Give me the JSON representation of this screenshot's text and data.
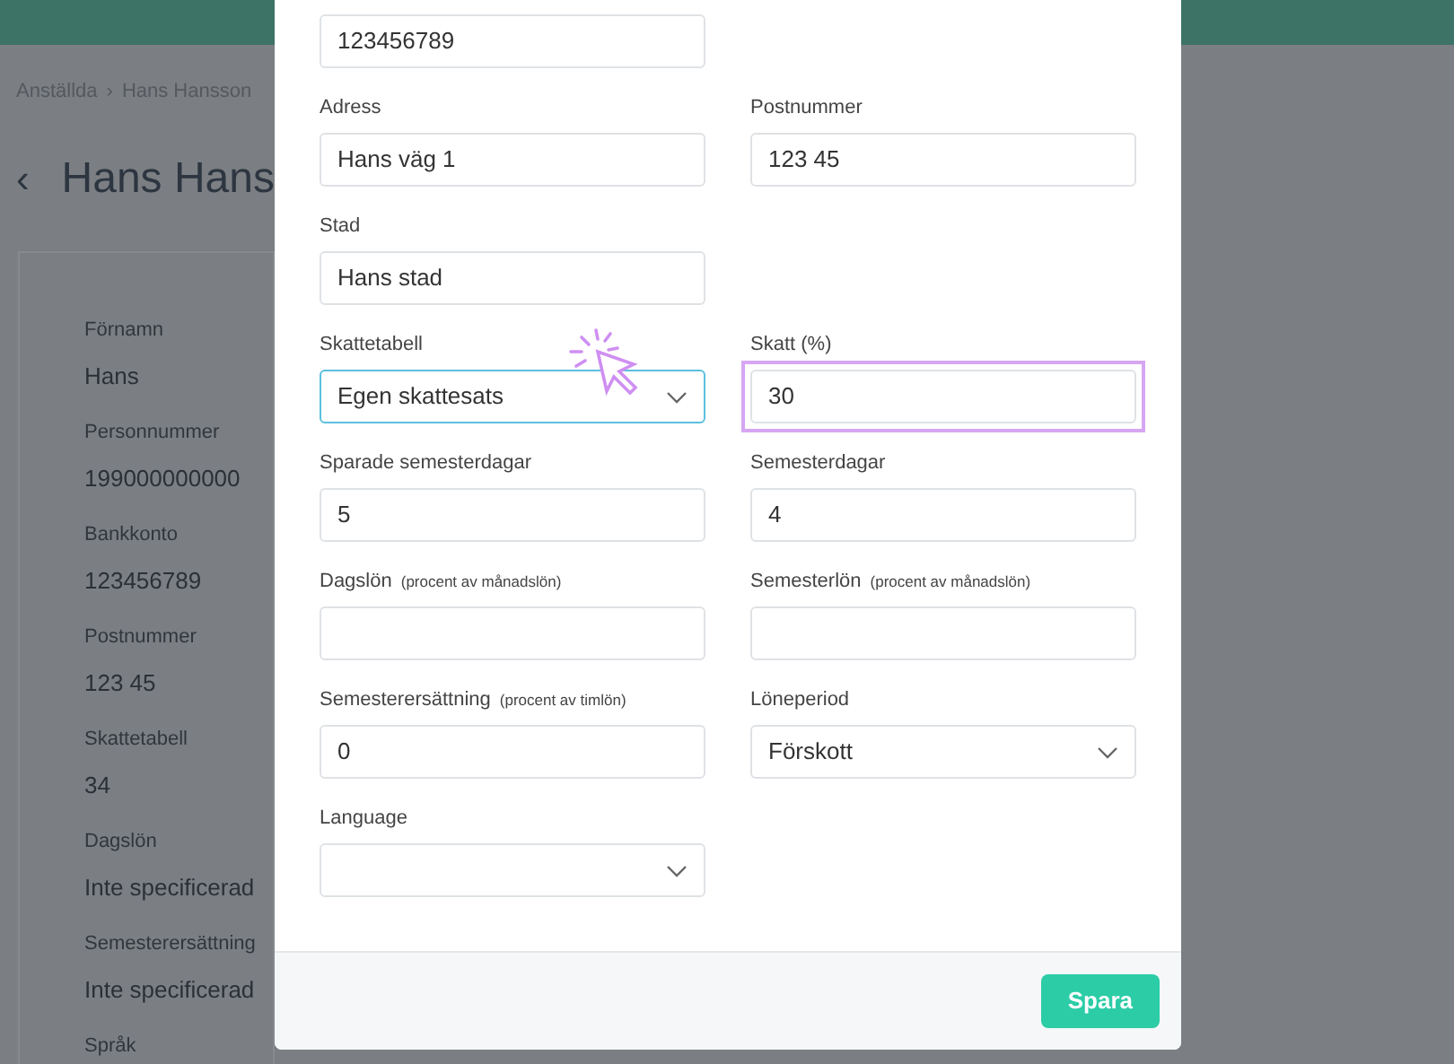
{
  "background": {
    "breadcrumb": [
      {
        "label": "Anställda"
      },
      {
        "label": "Hans Hansson"
      }
    ],
    "separator": "›",
    "back": "‹",
    "title": "Hans Hans",
    "details": [
      {
        "label": "Förnamn",
        "value": "Hans"
      },
      {
        "label": "Personnummer",
        "value": "199000000000"
      },
      {
        "label": "Bankkonto",
        "value": "123456789"
      },
      {
        "label": "Postnummer",
        "value": "123 45"
      },
      {
        "label": "Skattetabell",
        "value": "34"
      },
      {
        "label": "Dagslön",
        "value": "Inte specificerad"
      },
      {
        "label": "Semesterersättning",
        "value": "Inte specificerad"
      },
      {
        "label": "Språk"
      }
    ]
  },
  "modal": {
    "rows": [
      {
        "left": {
          "kind": "input",
          "value": "123456789",
          "focused": false,
          "highlighted": false
        }
      },
      {
        "left": {
          "kind": "input",
          "label": "Adress",
          "value": "Hans väg 1",
          "focused": false,
          "highlighted": false
        },
        "right": {
          "kind": "input",
          "label": "Postnummer",
          "value": "123 45",
          "focused": false,
          "highlighted": false
        }
      },
      {
        "left": {
          "kind": "input",
          "label": "Stad",
          "value": "Hans stad",
          "focused": false,
          "highlighted": false
        }
      },
      {
        "left": {
          "kind": "select",
          "label": "Skattetabell",
          "value": "Egen skattesats",
          "focused": true,
          "highlighted": false,
          "cursor": true
        },
        "right": {
          "kind": "input",
          "label": "Skatt (%)",
          "value": "30",
          "focused": false,
          "highlighted": true
        }
      },
      {
        "left": {
          "kind": "input",
          "label": "Sparade semesterdagar",
          "value": "5",
          "focused": false,
          "highlighted": false
        },
        "right": {
          "kind": "input",
          "label": "Semesterdagar",
          "value": "4",
          "focused": false,
          "highlighted": false
        }
      },
      {
        "left": {
          "kind": "input",
          "label": "Dagslön",
          "hint": "(procent av månadslön)",
          "focused": false,
          "highlighted": false
        },
        "right": {
          "kind": "input",
          "label": "Semesterlön",
          "hint": "(procent av månadslön)",
          "focused": false,
          "highlighted": false
        }
      },
      {
        "left": {
          "kind": "input",
          "label": "Semesterersättning",
          "hint": "(procent av timlön)",
          "value": "0",
          "focused": false,
          "highlighted": false
        },
        "right": {
          "kind": "select",
          "label": "Löneperiod",
          "value": "Förskott",
          "focused": false,
          "highlighted": false
        }
      },
      {
        "left": {
          "kind": "select",
          "label": "Language",
          "focused": false,
          "highlighted": false
        }
      }
    ],
    "save_button": "Spara"
  }
}
